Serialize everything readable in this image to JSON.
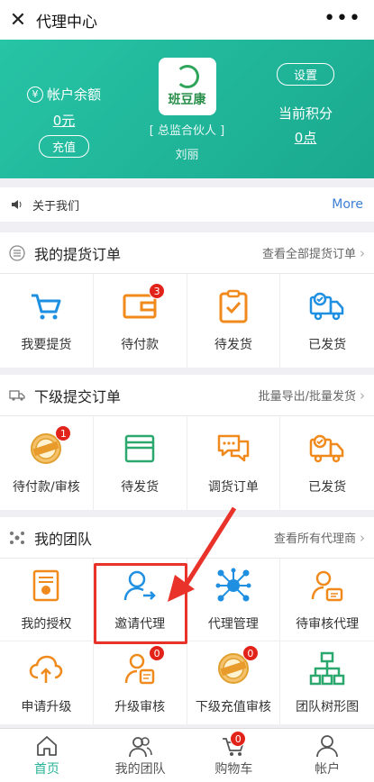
{
  "topbar": {
    "title": "代理中心",
    "close_icon": "close-icon",
    "more_icon": "more-dots-icon"
  },
  "hero": {
    "balance_label": "帐户余额",
    "balance_value": "0元",
    "recharge_label": "充值",
    "brand_name": "班豆康",
    "role": "[ 总监合伙人 ]",
    "user_name": "刘丽",
    "settings_label": "设置",
    "points_label": "当前积分",
    "points_value": "0点",
    "colors": {
      "background": "#1fb89b"
    }
  },
  "notice": {
    "text": "关于我们",
    "more": "More"
  },
  "orders": {
    "title": "我的提货订单",
    "link": "查看全部提货订单",
    "items": [
      {
        "label": "我要提货",
        "icon": "cart-icon",
        "badge": ""
      },
      {
        "label": "待付款",
        "icon": "wallet-icon",
        "badge": "3"
      },
      {
        "label": "待发货",
        "icon": "clipboard-check-icon",
        "badge": ""
      },
      {
        "label": "已发货",
        "icon": "truck-icon",
        "badge": ""
      }
    ]
  },
  "sub_orders": {
    "title": "下级提交订单",
    "link": "批量导出/批量发货",
    "items": [
      {
        "label": "待付款/审核",
        "icon": "pending-seal-icon",
        "badge": "1"
      },
      {
        "label": "待发货",
        "icon": "window-icon",
        "badge": ""
      },
      {
        "label": "调货订单",
        "icon": "chat-bubbles-icon",
        "badge": ""
      },
      {
        "label": "已发货",
        "icon": "truck-icon",
        "badge": ""
      }
    ]
  },
  "team": {
    "title": "我的团队",
    "link": "查看所有代理商",
    "items": [
      {
        "label": "我的授权",
        "icon": "certificate-icon",
        "badge": ""
      },
      {
        "label": "邀请代理",
        "icon": "invite-user-icon",
        "badge": ""
      },
      {
        "label": "代理管理",
        "icon": "network-icon",
        "badge": ""
      },
      {
        "label": "待审核代理",
        "icon": "user-card-icon",
        "badge": ""
      },
      {
        "label": "申请升级",
        "icon": "cloud-upload-icon",
        "badge": ""
      },
      {
        "label": "升级审核",
        "icon": "user-doc-icon",
        "badge": "0"
      },
      {
        "label": "下级充值审核",
        "icon": "pending-seal-icon",
        "badge": "0"
      },
      {
        "label": "团队树形图",
        "icon": "org-tree-icon",
        "badge": ""
      }
    ]
  },
  "tabbar": {
    "items": [
      {
        "label": "首页",
        "icon": "home-icon",
        "badge": ""
      },
      {
        "label": "我的团队",
        "icon": "team-icon",
        "badge": ""
      },
      {
        "label": "购物车",
        "icon": "cart-icon",
        "badge": "0"
      },
      {
        "label": "帐户",
        "icon": "user-icon",
        "badge": ""
      }
    ]
  }
}
